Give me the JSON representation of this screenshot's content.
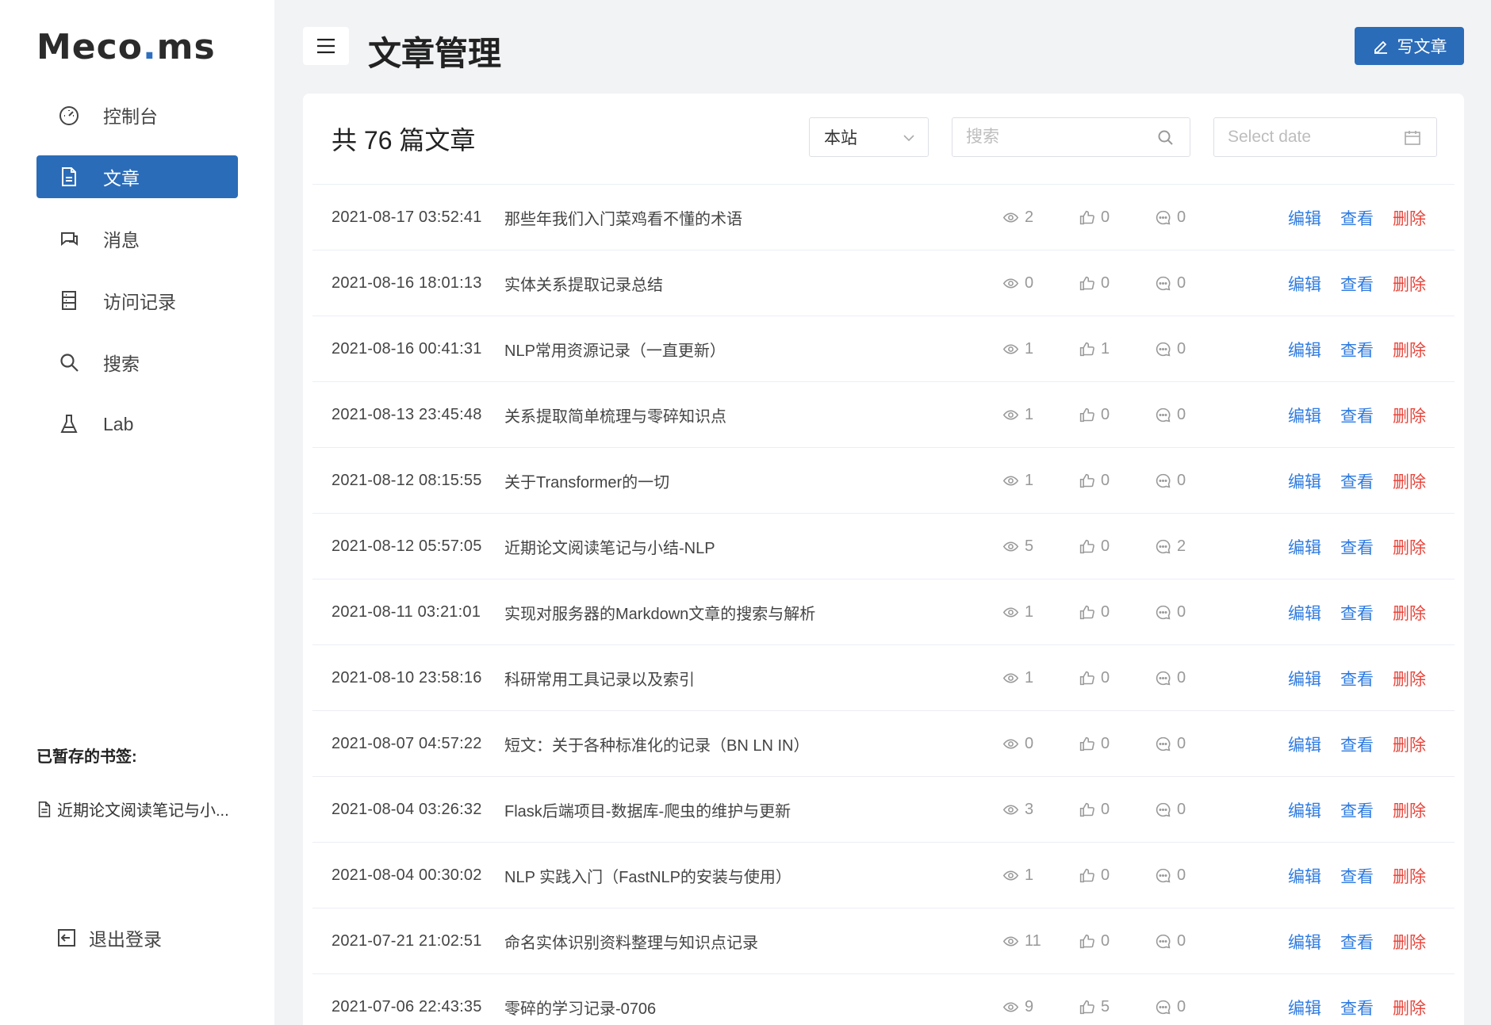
{
  "sidebar": {
    "logo_main": "Meco",
    "logo_dot": ".",
    "logo_tail": "ms",
    "items": [
      {
        "label": "控制台",
        "icon": "dashboard-icon"
      },
      {
        "label": "文章",
        "icon": "document-icon"
      },
      {
        "label": "消息",
        "icon": "chat-icon"
      },
      {
        "label": "访问记录",
        "icon": "log-icon"
      },
      {
        "label": "搜索",
        "icon": "search-icon"
      },
      {
        "label": "Lab",
        "icon": "flask-icon"
      }
    ],
    "active_index": 1,
    "saved_title": "已暂存的书签:",
    "saved_item": "近期论文阅读笔记与小...",
    "logout": "退出登录"
  },
  "header": {
    "title": "文章管理",
    "write_button": "写文章"
  },
  "toolbar": {
    "count_text": "共 76 篇文章",
    "scope_select": "本站",
    "search_placeholder": "搜索",
    "date_placeholder": "Select date"
  },
  "actions": {
    "edit": "编辑",
    "view": "查看",
    "delete": "删除"
  },
  "colors": {
    "primary": "#2b6cb8",
    "link": "#2f7be0",
    "danger": "#e8473d"
  },
  "articles": [
    {
      "date": "2021-08-17 03:52:41",
      "title": "那些年我们入门菜鸡看不懂的术语",
      "views": "2",
      "likes": "0",
      "comments": "0"
    },
    {
      "date": "2021-08-16 18:01:13",
      "title": "实体关系提取记录总结",
      "views": "0",
      "likes": "0",
      "comments": "0"
    },
    {
      "date": "2021-08-16 00:41:31",
      "title": "NLP常用资源记录（一直更新）",
      "views": "1",
      "likes": "1",
      "comments": "0"
    },
    {
      "date": "2021-08-13 23:45:48",
      "title": "关系提取简单梳理与零碎知识点",
      "views": "1",
      "likes": "0",
      "comments": "0"
    },
    {
      "date": "2021-08-12 08:15:55",
      "title": "关于Transformer的一切",
      "views": "1",
      "likes": "0",
      "comments": "0"
    },
    {
      "date": "2021-08-12 05:57:05",
      "title": "近期论文阅读笔记与小结-NLP",
      "views": "5",
      "likes": "0",
      "comments": "2"
    },
    {
      "date": "2021-08-11 03:21:01",
      "title": "实现对服务器的Markdown文章的搜索与解析",
      "views": "1",
      "likes": "0",
      "comments": "0"
    },
    {
      "date": "2021-08-10 23:58:16",
      "title": "科研常用工具记录以及索引",
      "views": "1",
      "likes": "0",
      "comments": "0"
    },
    {
      "date": "2021-08-07 04:57:22",
      "title": "短文：关于各种标准化的记录（BN LN IN）",
      "views": "0",
      "likes": "0",
      "comments": "0"
    },
    {
      "date": "2021-08-04 03:26:32",
      "title": "Flask后端项目-数据库-爬虫的维护与更新",
      "views": "3",
      "likes": "0",
      "comments": "0"
    },
    {
      "date": "2021-08-04 00:30:02",
      "title": "NLP 实践入门（FastNLP的安装与使用）",
      "views": "1",
      "likes": "0",
      "comments": "0"
    },
    {
      "date": "2021-07-21 21:02:51",
      "title": "命名实体识别资料整理与知识点记录",
      "views": "11",
      "likes": "0",
      "comments": "0"
    },
    {
      "date": "2021-07-06 22:43:35",
      "title": "零碎的学习记录-0706",
      "views": "9",
      "likes": "5",
      "comments": "0"
    }
  ]
}
